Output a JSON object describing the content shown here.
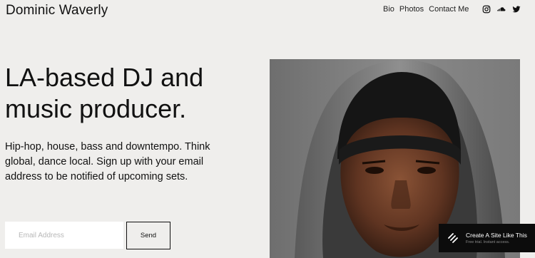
{
  "header": {
    "site_title": "Dominic Waverly",
    "nav": [
      {
        "label": "Bio"
      },
      {
        "label": "Photos"
      },
      {
        "label": "Contact Me"
      }
    ],
    "social_icons": [
      "instagram-icon",
      "soundcloud-icon",
      "twitter-icon"
    ]
  },
  "hero": {
    "headline_line1": "LA-based DJ and",
    "headline_line2": "music producer.",
    "blurb": "Hip-hop, house, bass and downtempo. Think global, dance local. Sign up with your email address to be notified of upcoming sets."
  },
  "signup": {
    "email_placeholder": "Email Address",
    "email_value": "",
    "send_label": "Send"
  },
  "promo": {
    "title": "Create A Site Like This",
    "subtitle": "Free trial. Instant access."
  },
  "colors": {
    "background": "#efeeec",
    "text": "#111111",
    "promo_bg": "#0c0c0c",
    "input_bg": "#ffffff"
  }
}
